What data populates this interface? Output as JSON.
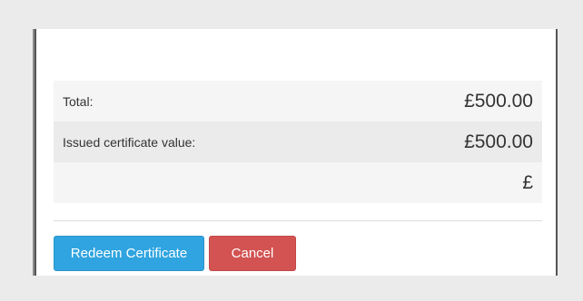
{
  "summary": {
    "rows": [
      {
        "label": "Total:",
        "value": "£500.00"
      },
      {
        "label": "Issued certificate value:",
        "value": "£500.00"
      },
      {
        "label": "",
        "value": "£"
      }
    ]
  },
  "actions": {
    "redeem_label": "Redeem Certificate",
    "cancel_label": "Cancel"
  },
  "colors": {
    "redeem_button": "#2fa4e0",
    "cancel_button": "#d25352"
  }
}
